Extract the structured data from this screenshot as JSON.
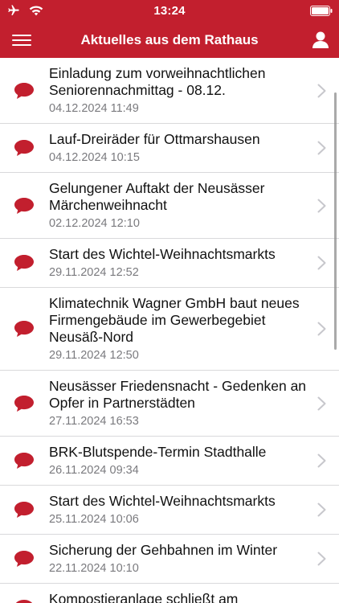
{
  "status": {
    "time": "13:24",
    "icons": [
      "airplane-icon",
      "wifi-icon",
      "battery-icon"
    ]
  },
  "header": {
    "title": "Aktuelles aus dem Rathaus",
    "menu_icon": "hamburger-menu-icon",
    "user_icon": "user-icon"
  },
  "colors": {
    "brand": "#c21f2e",
    "bubble": "#c21f2e",
    "date_text": "#7a7a7e"
  },
  "news": [
    {
      "title": "Einladung zum vorweihnachtlichen Seniorennachmittag - 08.12.",
      "date": "04.12.2024 11:49"
    },
    {
      "title": "Lauf-Dreiräder für Ottmarshausen",
      "date": "04.12.2024 10:15"
    },
    {
      "title": "Gelungener Auftakt der Neusässer Märchenweihnacht",
      "date": "02.12.2024 12:10"
    },
    {
      "title": "Start des Wichtel-Weihnachtsmarkts",
      "date": "29.11.2024 12:52"
    },
    {
      "title": "Klimatechnik Wagner GmbH baut neues Firmengebäude im Gewerbegebiet Neusäß-Nord",
      "date": "29.11.2024 12:50"
    },
    {
      "title": "Neusässer Friedensnacht - Gedenken an Opfer in Partnerstädten",
      "date": "27.11.2024 16:53"
    },
    {
      "title": "BRK-Blutspende-Termin Stadthalle",
      "date": "26.11.2024 09:34"
    },
    {
      "title": "Start des Wichtel-Weihnachtsmarkts",
      "date": "25.11.2024 10:06"
    },
    {
      "title": "Sicherung der Gehbahnen im Winter",
      "date": "22.11.2024 10:10"
    },
    {
      "title": "Kompostieranlage schließt am",
      "date": ""
    }
  ]
}
